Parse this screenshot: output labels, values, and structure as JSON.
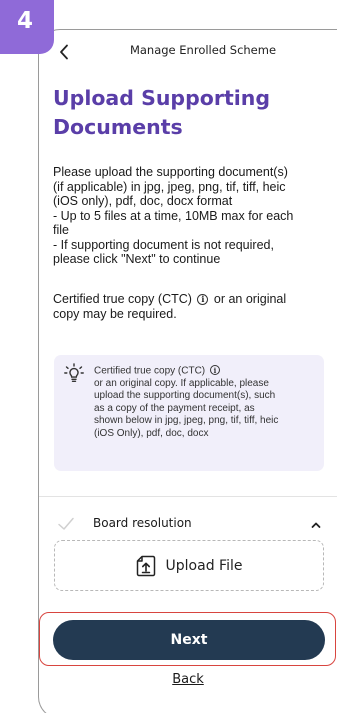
{
  "step_badge": "4",
  "header": {
    "title": "Manage Enrolled Scheme"
  },
  "page": {
    "title_line1": "Upload Supporting",
    "title_line2": "Documents"
  },
  "instructions": {
    "line1": "Please upload the supporting document(s)",
    "line2": "(if applicable) in jpg, jpeg, png, tif, tiff, heic",
    "line3": "(iOS only), pdf, doc, docx format",
    "line4": "- Up to 5 files at a time, 10MB max for each",
    "line5": "file",
    "line6": "- If supporting document is not required,",
    "line7": "please click \"Next\" to continue"
  },
  "ctc": {
    "before_icon": "Certified true copy (CTC)",
    "after_icon": " or an original",
    "line2": "copy may be required."
  },
  "info_box": {
    "icon": "lightbulb-icon",
    "title": "Certified true copy (CTC)",
    "line1": "or an original copy. If applicable, please",
    "line2": "upload the supporting document(s), such",
    "line3": "as a copy of the payment receipt, as",
    "line4": "shown below in jpg, jpeg, png, tif, tiff, heic",
    "line5": "(iOS Only), pdf, doc, docx"
  },
  "accordion": {
    "label": "Board resolution",
    "expanded": true
  },
  "upload": {
    "label": "Upload File"
  },
  "actions": {
    "next_label": "Next",
    "back_label": "Back"
  },
  "colors": {
    "badge": "#8f6ad8",
    "title": "#5a3ea8",
    "info_bg": "#f1effa",
    "primary_button": "#233a52",
    "highlight": "#d8453f"
  }
}
